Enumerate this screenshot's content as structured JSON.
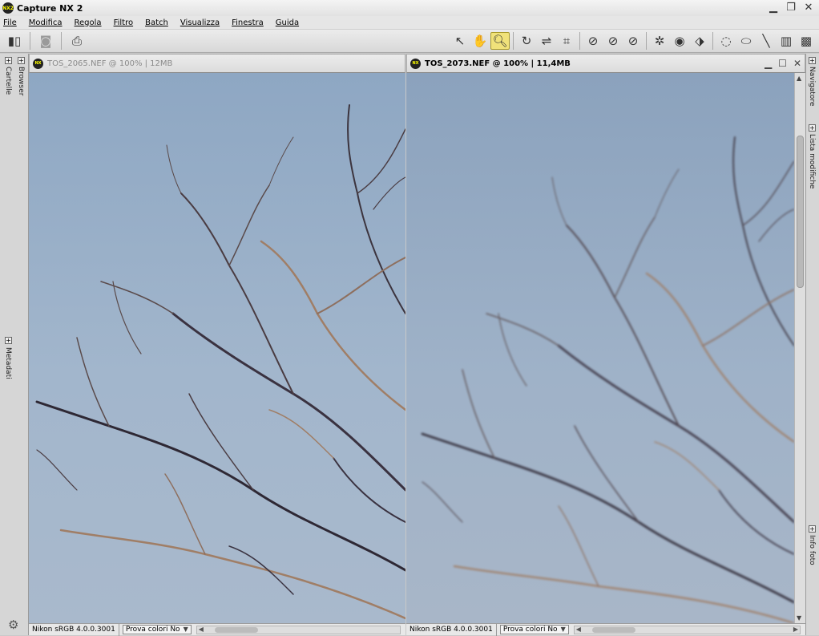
{
  "app": {
    "title": "Capture NX 2",
    "logo": "NX2"
  },
  "window_controls": {
    "minimize": "▁",
    "maximize": "❐",
    "close": "✕"
  },
  "menu": {
    "items": [
      "File",
      "Modifica",
      "Regola",
      "Filtro",
      "Batch",
      "Visualizza",
      "Finestra",
      "Guida"
    ]
  },
  "toolbar": {
    "left_icons": [
      "layout-icon",
      "camera-icon",
      "print-icon"
    ],
    "right_icons": [
      "arrow-select-icon",
      "hand-icon",
      "zoom-icon",
      "rotate-icon",
      "straighten-icon",
      "crop-icon",
      "black-point-icon",
      "white-point-icon",
      "gray-point-icon",
      "red-eye-icon",
      "eye-icon",
      "auto-retouch-icon",
      "lasso-icon",
      "marquee-icon",
      "brush-icon",
      "gradient-icon",
      "fill-icon"
    ],
    "active_tool": "zoom-icon"
  },
  "left_sidebar": {
    "tabs": [
      "Cartelle",
      "Browser",
      "Metadati"
    ]
  },
  "right_sidebar": {
    "tabs": [
      "Navigatore",
      "Lista modifiche",
      "Info foto"
    ]
  },
  "panes": [
    {
      "title": "TOS_2065.NEF @ 100% | 12MB",
      "active": false,
      "status_profile": "Nikon sRGB 4.0.0.3001",
      "status_proof": "Prova colori No"
    },
    {
      "title": "TOS_2073.NEF @ 100% | 11,4MB",
      "active": true,
      "status_profile": "Nikon sRGB 4.0.0.3001",
      "status_proof": "Prova colori No"
    }
  ],
  "colors": {
    "sky_top": "#8ea7c3",
    "sky_bottom": "#a9b9cc",
    "branch_dark": "#3d3440",
    "branch_warm": "#a07e66",
    "active_tool_bg": "#f0e27a"
  }
}
